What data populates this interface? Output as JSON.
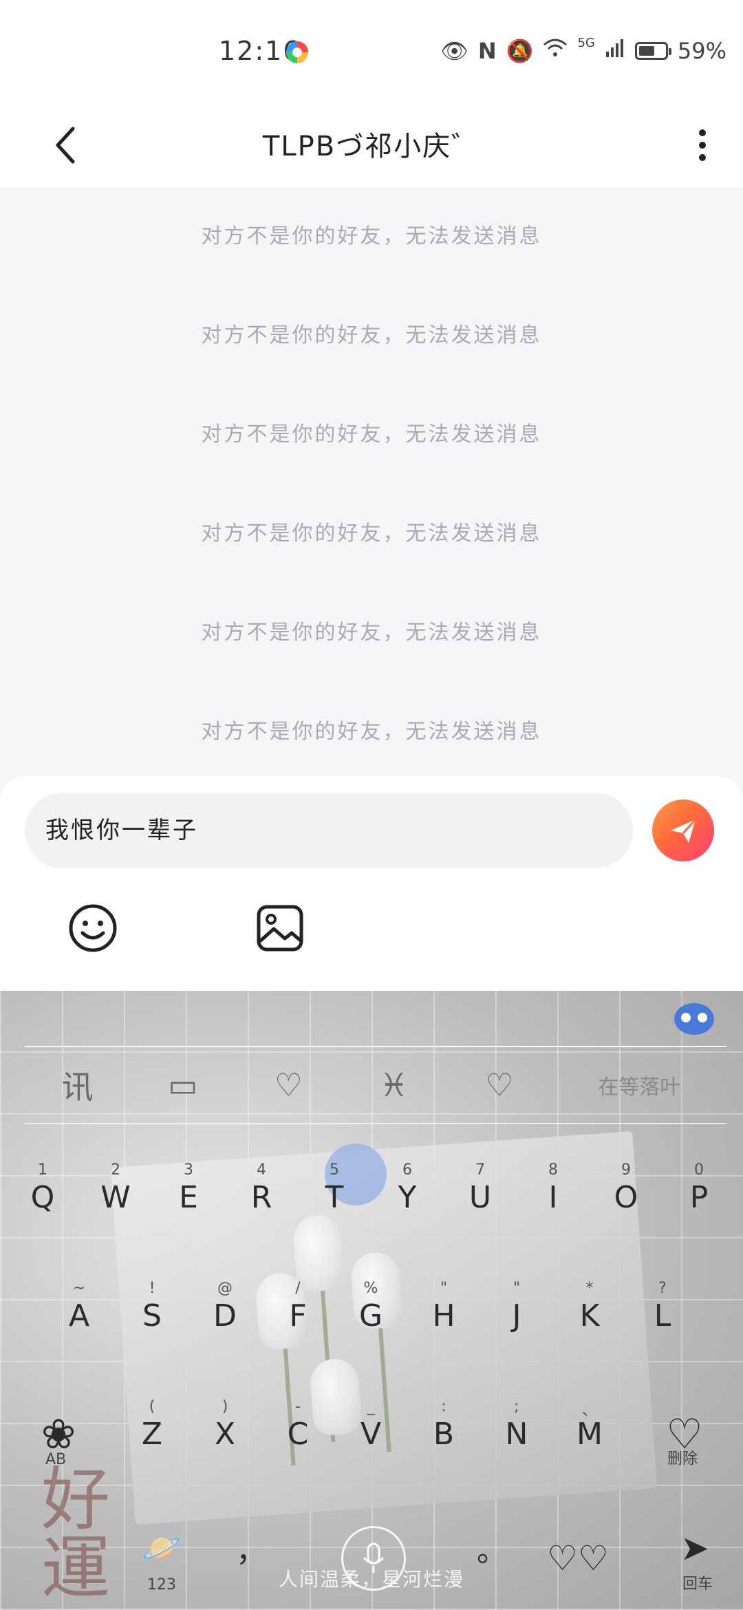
{
  "status_bar": {
    "time": "12:16",
    "network": "5G",
    "battery": "59%"
  },
  "header": {
    "title": "TLPBづ祁小庆゛"
  },
  "chat": {
    "system_messages": [
      "对方不是你的好友，无法发送消息",
      "对方不是你的好友，无法发送消息",
      "对方不是你的好友，无法发送消息",
      "对方不是你的好友，无法发送消息",
      "对方不是你的好友，无法发送消息",
      "对方不是你的好友，无法发送消息"
    ]
  },
  "composer": {
    "input_value": "我恨你一辈子",
    "send_icon": "paper-plane-icon",
    "send_color": "#ff5a4e",
    "emoji_icon": "smiley-icon",
    "image_icon": "image-icon"
  },
  "keyboard": {
    "toolbar": [
      "讯",
      "▭",
      "♡",
      "♓",
      "♡",
      "在等落叶"
    ],
    "row1": [
      {
        "key": "Q",
        "hint": "1"
      },
      {
        "key": "W",
        "hint": "2"
      },
      {
        "key": "E",
        "hint": "3"
      },
      {
        "key": "R",
        "hint": "4"
      },
      {
        "key": "T",
        "hint": "5"
      },
      {
        "key": "Y",
        "hint": "6"
      },
      {
        "key": "U",
        "hint": "7"
      },
      {
        "key": "I",
        "hint": "8"
      },
      {
        "key": "O",
        "hint": "9"
      },
      {
        "key": "P",
        "hint": "0"
      }
    ],
    "row2": [
      {
        "key": "A",
        "hint": "~"
      },
      {
        "key": "S",
        "hint": "!"
      },
      {
        "key": "D",
        "hint": "@"
      },
      {
        "key": "F",
        "hint": "/"
      },
      {
        "key": "G",
        "hint": "%"
      },
      {
        "key": "H",
        "hint": "\""
      },
      {
        "key": "J",
        "hint": "\""
      },
      {
        "key": "K",
        "hint": "*"
      },
      {
        "key": "L",
        "hint": "?"
      }
    ],
    "row3": [
      {
        "key": "Z",
        "hint": "("
      },
      {
        "key": "X",
        "hint": ")"
      },
      {
        "key": "C",
        "hint": "-"
      },
      {
        "key": "V",
        "hint": "_"
      },
      {
        "key": "B",
        "hint": ":"
      },
      {
        "key": "N",
        "hint": ";"
      },
      {
        "key": "M",
        "hint": "、"
      }
    ],
    "shift_label": "AB",
    "delete_label": "删除",
    "numbers_label": "123",
    "comma_label": "，",
    "period_label": "。",
    "enter_label": "回车",
    "space_text": "人间温柔，星河烂漫",
    "deco_text": "好運"
  }
}
